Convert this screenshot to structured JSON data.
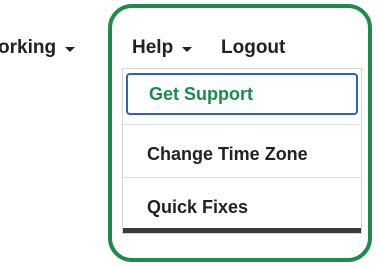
{
  "nav": {
    "networking_label": "orking",
    "help_label": "Help",
    "logout_label": "Logout"
  },
  "dropdown": {
    "items": [
      {
        "label": "Get Support"
      },
      {
        "label": "Change Time Zone"
      },
      {
        "label": "Quick Fixes"
      }
    ]
  },
  "colors": {
    "highlight_frame": "#1f8a4c",
    "active_item_text": "#1f8a4c",
    "focus_outline": "#2f62b8",
    "text": "#222222"
  }
}
